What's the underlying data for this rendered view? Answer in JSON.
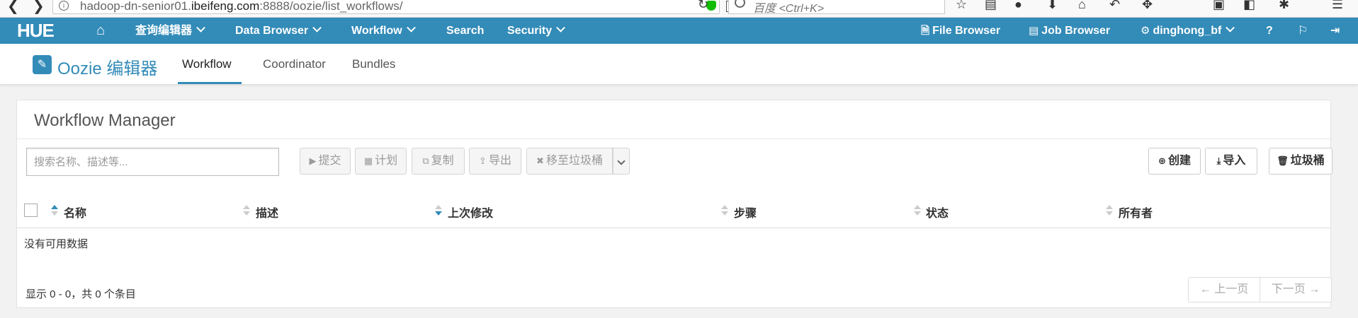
{
  "browser": {
    "back_icon": "back-arrow-icon",
    "forward_icon": "forward-arrow-icon",
    "url_host_prefix": "hadoop-dn-senior01.",
    "url_host_domain": "ibeifeng.com",
    "url_path": ":8888/oozie/list_workflows/",
    "search_placeholder": "百度 <Ctrl+K>"
  },
  "hue": {
    "logo": "HUE",
    "nav": {
      "query_editors": "查询编辑器",
      "data_browser": "Data Browser",
      "workflow": "Workflow",
      "search": "Search",
      "security": "Security",
      "file_browser": "File Browser",
      "job_browser": "Job Browser",
      "user": "dinghong_bf"
    }
  },
  "oozie": {
    "title": "Oozie 编辑器",
    "tabs": [
      "Workflow",
      "Coordinator",
      "Bundles"
    ],
    "active_tab": "Workflow"
  },
  "manager": {
    "title": "Workflow Manager",
    "search_placeholder": "搜索名称、描述等...",
    "actions": {
      "submit": "提交",
      "schedule": "计划",
      "copy": "复制",
      "export": "导出",
      "move_to_trash": "移至垃圾桶",
      "create": "创建",
      "import": "导入",
      "trash": "垃圾桶"
    },
    "columns": [
      "名称",
      "描述",
      "上次修改",
      "步骤",
      "状态",
      "所有者"
    ],
    "empty_text": "没有可用数据",
    "count_text": "显示 0 - 0，共 0 个条目",
    "pager": {
      "prev": "← 上一页",
      "next": "下一页 →"
    }
  },
  "colors": {
    "accent": "#338bb8",
    "page_bg": "#f2f2f2"
  }
}
